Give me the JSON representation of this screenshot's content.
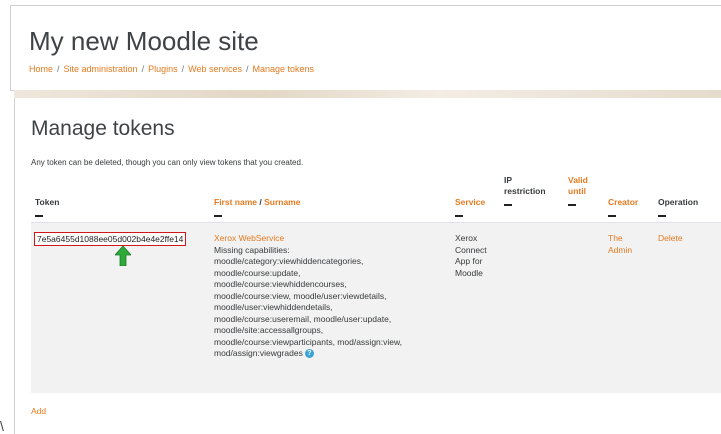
{
  "header": {
    "site_title": "My new Moodle site",
    "breadcrumb": [
      "Home",
      "Site administration",
      "Plugins",
      "Web services",
      "Manage tokens"
    ]
  },
  "page": {
    "heading": "Manage tokens",
    "intro": "Any token can be deleted, though you can only view tokens that you created."
  },
  "table": {
    "headers": {
      "token": "Token",
      "first_name": "First name",
      "slash": " / ",
      "surname": "Surname",
      "service": "Service",
      "ip_restriction": "IP restriction",
      "valid_until": "Valid until",
      "creator": "Creator",
      "operation": "Operation"
    },
    "row": {
      "token": "7e5a6455d1088ee05d002b4e4e2ffe14",
      "user_link": "Xerox WebService",
      "missing_capabilities": [
        "Missing capabilities:",
        "moodle/category:viewhiddencategories,",
        "moodle/course:update,",
        "moodle/course:viewhiddencourses,",
        "moodle/course:view, moodle/user:viewdetails,",
        "moodle/user:viewhiddendetails,",
        "moodle/course:useremail, moodle/user:update,",
        "moodle/site:accessallgroups,",
        "moodle/course:viewparticipants, mod/assign:view,",
        "mod/assign:viewgrades"
      ],
      "service": [
        "Xerox",
        "Connect",
        "App for",
        "Moodle"
      ],
      "creator": [
        "The",
        "Admin"
      ],
      "operation": "Delete"
    }
  },
  "footer": {
    "add_label": "Add"
  },
  "icons": {
    "info": "help-circle-icon",
    "arrow": "green-up-arrow-icon"
  },
  "colors": {
    "link": "#e57a1f",
    "token_border": "#d0171c",
    "arrow": "#2eaa3a",
    "info": "#3aa3d6"
  },
  "misc": {
    "left_glyph": "\\"
  }
}
